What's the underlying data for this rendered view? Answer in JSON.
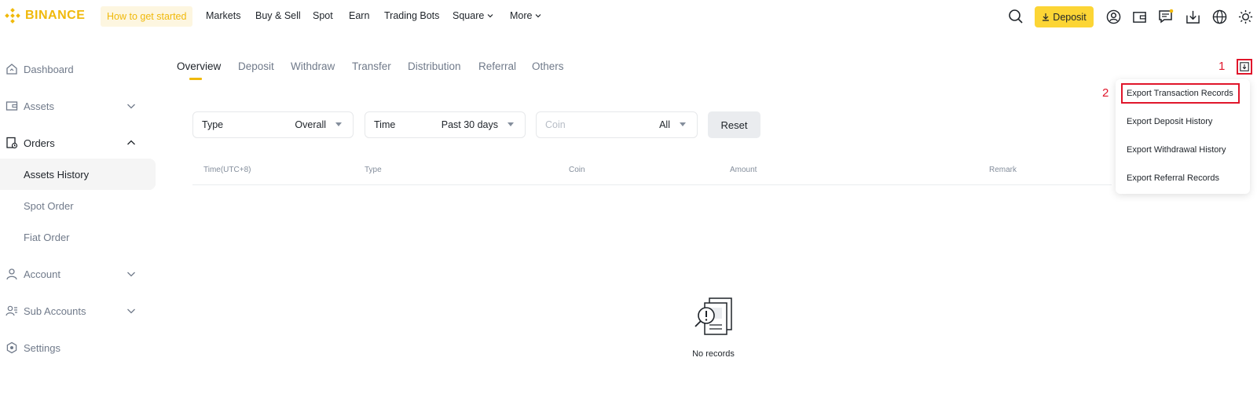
{
  "brand": {
    "name": "BINANCE",
    "color": "#f0b90b"
  },
  "topnav": {
    "how_to_get_started": "How to get started",
    "items": [
      "Markets",
      "Buy & Sell",
      "Spot",
      "Earn",
      "Trading Bots",
      "Square",
      "More"
    ],
    "deposit_label": "Deposit",
    "icons": [
      "search-icon",
      "profile-icon",
      "wallet-icon",
      "messages-icon",
      "download-icon",
      "language-icon",
      "theme-icon"
    ]
  },
  "sidebar": {
    "items": [
      {
        "label": "Dashboard"
      },
      {
        "label": "Assets"
      },
      {
        "label": "Orders"
      },
      {
        "label": "Assets History"
      },
      {
        "label": "Spot Order"
      },
      {
        "label": "Fiat Order"
      },
      {
        "label": "Account"
      },
      {
        "label": "Sub Accounts"
      },
      {
        "label": "Settings"
      }
    ]
  },
  "tabs": [
    "Overview",
    "Deposit",
    "Withdraw",
    "Transfer",
    "Distribution",
    "Referral",
    "Others"
  ],
  "filters": {
    "type": {
      "label": "Type",
      "value": "Overall"
    },
    "time": {
      "label": "Time",
      "value": "Past 30 days"
    },
    "coin": {
      "placeholder": "Coin",
      "value": "All"
    },
    "reset_label": "Reset"
  },
  "table": {
    "columns": [
      "Time(UTC+8)",
      "Type",
      "Coin",
      "Amount",
      "Remark"
    ]
  },
  "empty_state": {
    "text": "No records"
  },
  "annotations": {
    "step1": "1",
    "step2": "2",
    "color": "#e0162b"
  },
  "export_menu": {
    "items": [
      "Export Transaction Records",
      "Export Deposit History",
      "Export Withdrawal History",
      "Export Referral Records"
    ]
  },
  "colors": {
    "accent": "#f0b90b",
    "deposit_button": "#fcd535",
    "annotation": "#e0162b"
  }
}
